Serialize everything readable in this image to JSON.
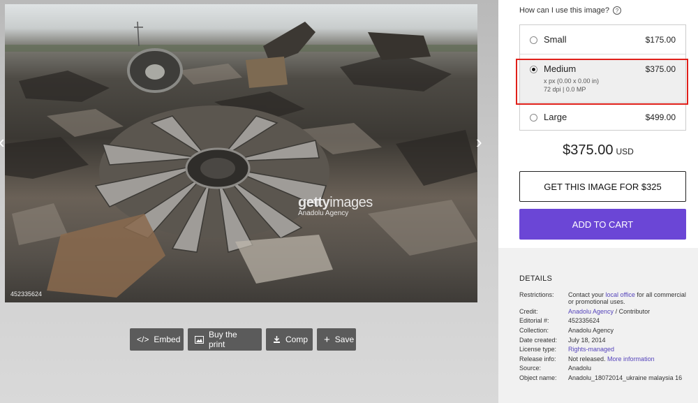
{
  "image": {
    "watermark_brand_bold": "getty",
    "watermark_brand_light": "images",
    "watermark_credit": "Anadolu Agency",
    "id_label": "452335624"
  },
  "toolbar": {
    "embed_label": "Embed",
    "buy_print_label": "Buy the print",
    "comp_label": "Comp",
    "save_label": "Save"
  },
  "license": {
    "question": "How can I use this image?",
    "options": [
      {
        "name": "Small",
        "price": "$175.00",
        "selected": false
      },
      {
        "name": "Medium",
        "price": "$375.00",
        "selected": true,
        "detail1": "x px (0.00 x 0.00 in)",
        "detail2": "72 dpi | 0.0 MP"
      },
      {
        "name": "Large",
        "price": "$499.00",
        "selected": false
      }
    ],
    "total_price": "$375.00",
    "currency": "USD",
    "get_image_label": "GET THIS IMAGE FOR $325",
    "add_to_cart_label": "ADD TO CART",
    "highlight_color": "#e0201a",
    "cart_color": "#6b46d6"
  },
  "details": {
    "heading": "DETAILS",
    "restrictions_key": "Restrictions:",
    "restrictions_pre": "Contact your",
    "restrictions_link": "local office",
    "restrictions_post": "for all commercial or promotional uses.",
    "credit_key": "Credit:",
    "credit_link": "Anadolu Agency",
    "credit_post": "/ Contributor",
    "editorial_key": "Editorial #:",
    "editorial_value": "452335624",
    "collection_key": "Collection:",
    "collection_value": "Anadolu Agency",
    "date_key": "Date created:",
    "date_value": "July 18, 2014",
    "license_key": "License type:",
    "license_link": "Rights-managed",
    "release_key": "Release info:",
    "release_value": "Not released.",
    "release_link": "More information",
    "source_key": "Source:",
    "source_value": "Anadolu",
    "object_key": "Object name:",
    "object_value": "Anadolu_18072014_ukraine malaysia 16"
  }
}
